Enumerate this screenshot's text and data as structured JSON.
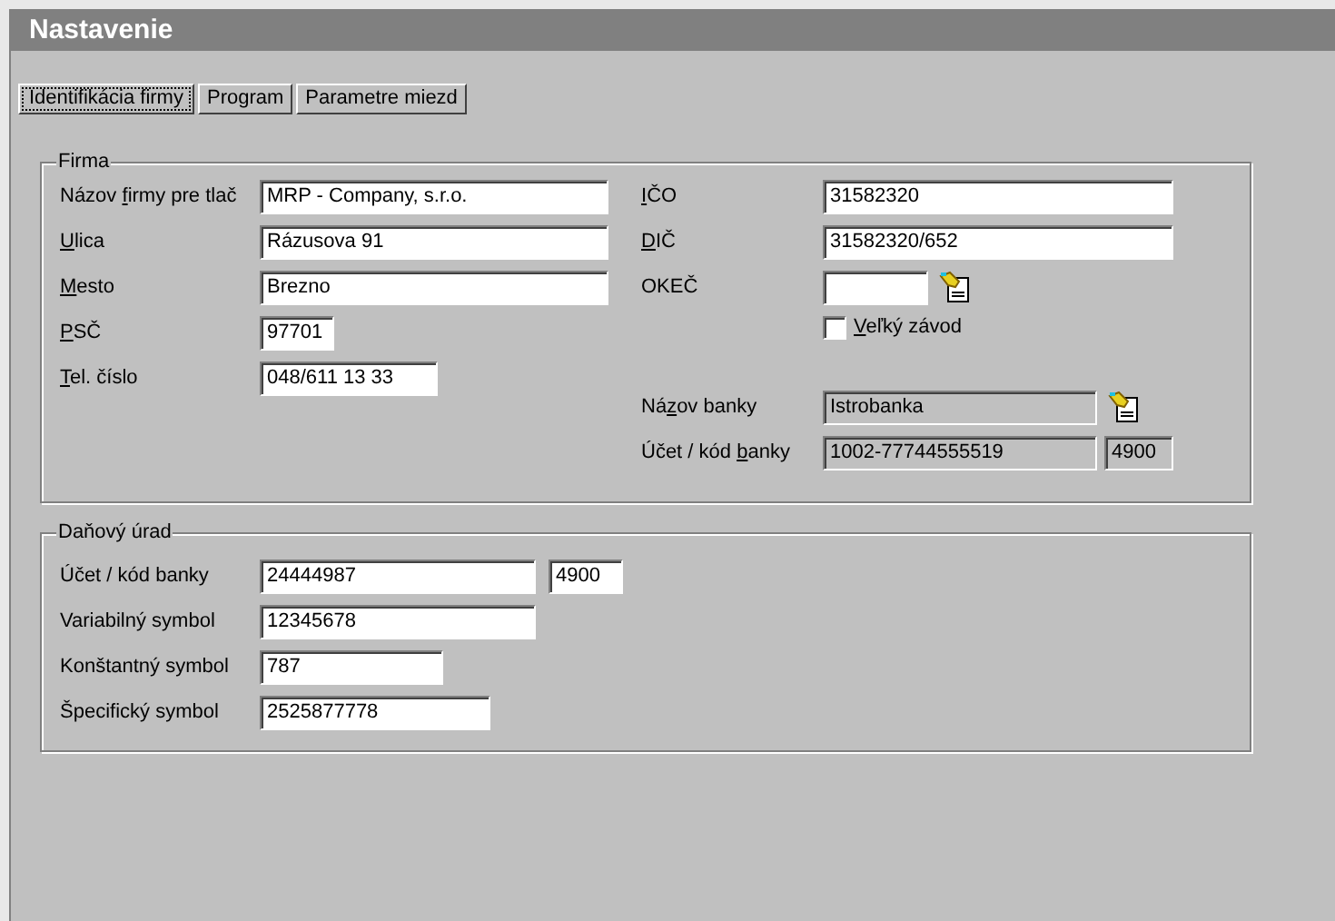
{
  "window": {
    "title": "Nastavenie"
  },
  "tabs": [
    {
      "label": "Identifikácia firmy",
      "selected": true
    },
    {
      "label": "Program",
      "selected": false
    },
    {
      "label": "Parametre miezd",
      "selected": false
    }
  ],
  "firma": {
    "title": "Firma",
    "left_fields": [
      {
        "kind": "input",
        "label_lead": "Názov ",
        "access_key": "f",
        "label_rest": "irmy pre tlač",
        "value": "MRP - Company, s.r.o.",
        "disabled": false
      },
      {
        "kind": "input",
        "access_key": "U",
        "label_rest": "lica",
        "value": "Rázusova 91",
        "disabled": false
      },
      {
        "kind": "input",
        "access_key": "M",
        "label_rest": "esto",
        "value": "Brezno",
        "disabled": false
      },
      {
        "kind": "input",
        "access_key": "P",
        "label_rest": "SČ",
        "value": "97701",
        "disabled": false
      },
      {
        "kind": "input",
        "access_key": "T",
        "label_rest": "el. číslo",
        "value": "048/611 13 33",
        "disabled": false
      }
    ],
    "right_fields": [
      {
        "kind": "input",
        "access_key": "I",
        "label_rest": "ČO",
        "value": "31582320",
        "disabled": false
      },
      {
        "kind": "input",
        "access_key": "D",
        "label_rest": "IČ",
        "value": "31582320/652",
        "disabled": false
      },
      {
        "kind": "lookup",
        "label": "OKEČ",
        "disabled": false
      },
      {
        "kind": "checkbox",
        "access_key": "V",
        "label_rest": "eľký závod",
        "checked": false
      },
      {
        "kind": "spacer"
      },
      {
        "kind": "lookup",
        "label_lead": "Ná",
        "access_key": "z",
        "label_rest": "ov banky",
        "value": "Istrobanka",
        "disabled": true
      },
      {
        "kind": "pair",
        "label_lead": "Účet / kód ",
        "access_key": "b",
        "label_rest": "anky",
        "value": "1002-77744555519",
        "code": "4900",
        "disabled": true
      }
    ]
  },
  "danovy_urad": {
    "title": "Daňový úrad",
    "fields": [
      {
        "kind": "pair",
        "label": "Účet / kód banky",
        "value": "24444987",
        "code": "4900",
        "disabled": false
      },
      {
        "kind": "input",
        "label": "Variabilný symbol",
        "value": "12345678",
        "disabled": false
      },
      {
        "kind": "input",
        "label": "Konštantný symbol",
        "value": "787",
        "disabled": false
      },
      {
        "kind": "input",
        "label": "Špecifický symbol",
        "value": "2525877778",
        "disabled": false
      }
    ]
  }
}
